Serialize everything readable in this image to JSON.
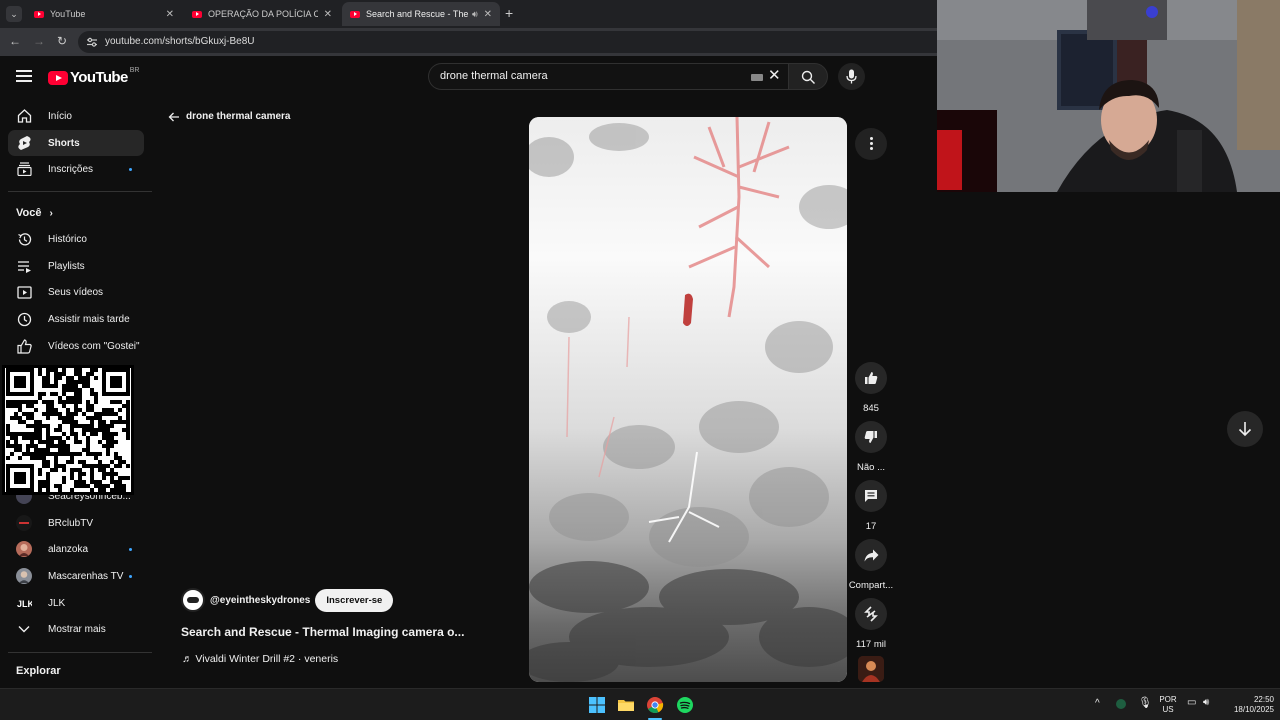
{
  "browser": {
    "tabs": [
      {
        "title": "YouTube",
        "active": false
      },
      {
        "title": "OPERAÇÃO DA POLÍCIA CIVIL I",
        "active": false
      },
      {
        "title": "Search and Rescue - Therm",
        "active": true
      }
    ],
    "url": "youtube.com/shorts/bGkuxj-Be8U"
  },
  "header": {
    "logo_text": "YouTube",
    "country_code": "BR",
    "search_value": "drone thermal camera"
  },
  "sidebar": {
    "main": [
      {
        "label": "Início",
        "icon": "home-icon"
      },
      {
        "label": "Shorts",
        "icon": "shorts-icon",
        "active": true
      },
      {
        "label": "Inscrições",
        "icon": "subscriptions-icon"
      }
    ],
    "you_title": "Você",
    "you": [
      {
        "label": "Histórico",
        "icon": "history-icon"
      },
      {
        "label": "Playlists",
        "icon": "playlists-icon"
      },
      {
        "label": "Seus vídeos",
        "icon": "your-videos-icon"
      },
      {
        "label": "Assistir mais tarde",
        "icon": "watch-later-icon"
      },
      {
        "label": "Vídeos com \"Gostei\"",
        "icon": "liked-icon"
      }
    ],
    "subscriptions": [
      {
        "label": "Seacreysonnceb..."
      },
      {
        "label": "BRclubTV"
      },
      {
        "label": "alanzoka"
      },
      {
        "label": "Mascarenhas TV"
      },
      {
        "label": "JLK"
      }
    ],
    "show_more": "Mostrar mais",
    "explore_title": "Explorar"
  },
  "short": {
    "back_label": "drone thermal camera",
    "channel": "@eyeintheskydrones",
    "subscribe": "Inscrever-se",
    "title": "Search and Rescue - Thermal Imaging camera o...",
    "music": "♬ Vivaldi Winter Drill #2 · veneris",
    "actions": {
      "likes": "845",
      "dislike": "Não ...",
      "comments": "17",
      "share": "Compart...",
      "remix": "117 mil"
    }
  },
  "taskbar": {
    "lang_top": "POR",
    "lang_bottom": "US",
    "time": "22:50",
    "date": "18/10/2025"
  },
  "colors": {
    "background": "#0f0f0f",
    "yt_red": "#ff0033",
    "thermal_hot": "#e06464"
  }
}
